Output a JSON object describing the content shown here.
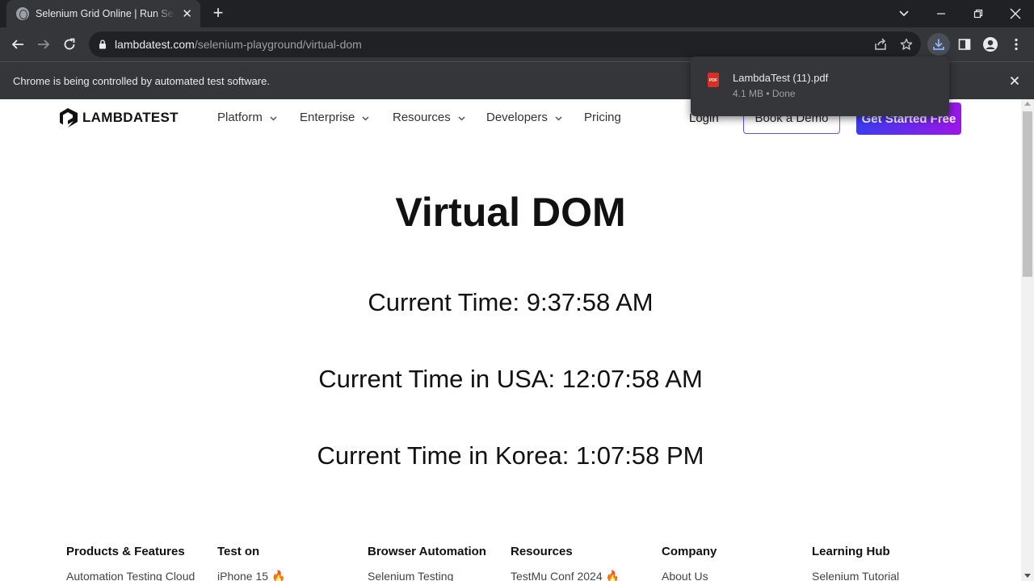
{
  "browser": {
    "tab_title": "Selenium Grid Online | Run Selenium Test Scripts",
    "url_host": "lambdatest.com",
    "url_path": "/selenium-playground/virtual-dom",
    "infobar_message": "Chrome is being controlled by automated test software.",
    "download": {
      "file_name": "LambdaTest (11).pdf",
      "meta": "4.1 MB • Done",
      "file_icon_label": "PDF"
    }
  },
  "header": {
    "brand": "LAMBDATEST",
    "nav": [
      {
        "label": "Platform"
      },
      {
        "label": "Enterprise"
      },
      {
        "label": "Resources"
      },
      {
        "label": "Developers"
      },
      {
        "label": "Pricing"
      }
    ],
    "login": "Login",
    "demo": "Book a Demo",
    "cta": "Get Started Free"
  },
  "main": {
    "title": "Virtual DOM",
    "current_time": "Current Time: 9:37:58 AM",
    "usa_time": "Current Time in USA: 12:07:58 AM",
    "korea_time": "Current Time in Korea: 1:07:58 PM"
  },
  "footer": {
    "columns": [
      {
        "heading": "Products & Features",
        "first_link": "Automation Testing Cloud"
      },
      {
        "heading": "Test on",
        "first_link": "iPhone 15 🔥"
      },
      {
        "heading": "Browser Automation",
        "first_link": "Selenium Testing"
      },
      {
        "heading": "Resources",
        "first_link": "TestMu Conf 2024 🔥"
      },
      {
        "heading": "Company",
        "first_link": "About Us"
      },
      {
        "heading": "Learning Hub",
        "first_link": "Selenium Tutorial"
      }
    ]
  },
  "colors": {
    "cta_gradient_start": "#3b3cf0",
    "cta_gradient_end": "#9c16e8",
    "chrome_dark": "#202124",
    "chrome_toolbar": "#35363a"
  }
}
